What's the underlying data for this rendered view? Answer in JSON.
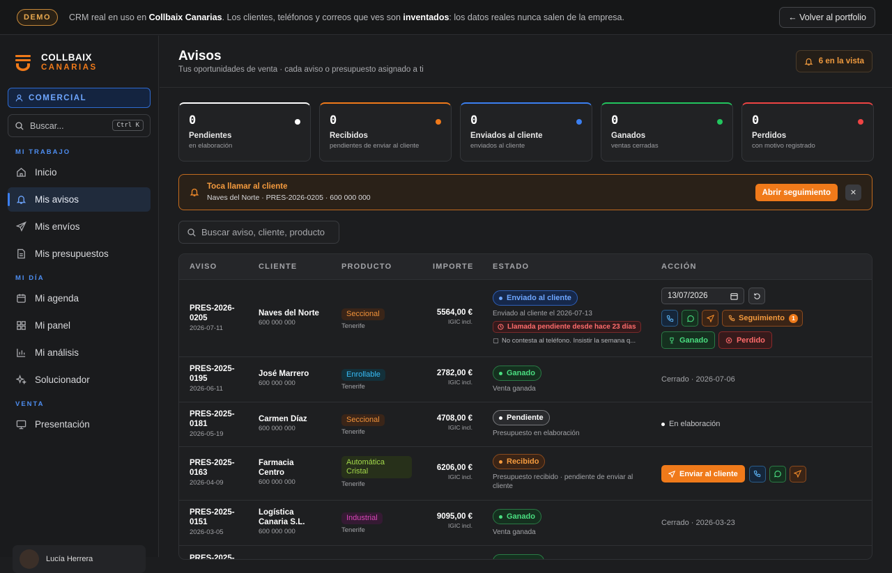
{
  "topbar": {
    "badge": "DEMO",
    "text_pre": "CRM real en uso en ",
    "text_company": "Collbaix Canarias",
    "text_mid": ". Los clientes, teléfonos y correos que ves son ",
    "text_bold": "inventados",
    "text_post": ": los datos reales nunca salen de la empresa.",
    "portfolio_btn": "← Volver al portfolio"
  },
  "sidebar": {
    "brand_line1": "COLLBAIX",
    "brand_line2": "CANARIAS",
    "role": "COMERCIAL",
    "search_placeholder": "Buscar...",
    "search_kbd": "Ctrl K",
    "section_work": "MI TRABAJO",
    "section_day": "MI DÍA",
    "section_sale": "VENTA",
    "items": [
      {
        "label": "Inicio",
        "icon": "home-icon"
      },
      {
        "label": "Mis avisos",
        "icon": "bell-icon"
      },
      {
        "label": "Mis envíos",
        "icon": "send-icon"
      },
      {
        "label": "Mis presupuestos",
        "icon": "document-icon"
      },
      {
        "label": "Mi agenda",
        "icon": "calendar-icon"
      },
      {
        "label": "Mi panel",
        "icon": "grid-icon"
      },
      {
        "label": "Mi análisis",
        "icon": "chart-icon"
      },
      {
        "label": "Solucionador",
        "icon": "sparkle-icon"
      },
      {
        "label": "Presentación",
        "icon": "monitor-icon"
      }
    ],
    "user_name": "Lucía Herrera"
  },
  "header": {
    "title": "Avisos",
    "subtitle": "Tus oportunidades de venta · cada aviso o presupuesto asignado a ti",
    "view_count": "6 en la vista"
  },
  "cards": [
    {
      "num": "0",
      "title": "Pendientes",
      "desc": "en elaboración",
      "color": "#ffffff"
    },
    {
      "num": "0",
      "title": "Recibidos",
      "desc": "pendientes de enviar al cliente",
      "color": "#f07a1a"
    },
    {
      "num": "0",
      "title": "Enviados al cliente",
      "desc": "enviados al cliente",
      "color": "#3b7ff0"
    },
    {
      "num": "0",
      "title": "Ganados",
      "desc": "ventas cerradas",
      "color": "#22c55e"
    },
    {
      "num": "0",
      "title": "Perdidos",
      "desc": "con motivo registrado",
      "color": "#ef4444"
    }
  ],
  "alert": {
    "title": "Toca llamar al cliente",
    "detail": "Naves del Norte · PRES-2026-0205 · 600 000 000",
    "button": "Abrir seguimiento",
    "close": "✕"
  },
  "list_search_placeholder": "Buscar aviso, cliente, producto",
  "table": {
    "headers": [
      "AVISO",
      "CLIENTE",
      "PRODUCTO",
      "IMPORTE",
      "ESTADO",
      "ACCIÓN"
    ],
    "rows": [
      {
        "code1": "PRES-2026-",
        "code2": "0205",
        "date": "2026-07-11",
        "client": "Naves del Norte",
        "phone": "600 000 000",
        "product": "Seccional",
        "region": "Tenerife",
        "amount": "5564,00 €",
        "tax": "IGIC incl.",
        "status": "Enviado al cliente",
        "status_sub": "Enviado al cliente el 2026-07-13",
        "warning": "Llamada pendiente desde hace 23 días",
        "note": "No contesta al teléfono. Insistir la semana q...",
        "action_date": "13/07/2026",
        "follow_label": "Seguimiento",
        "follow_count": "1",
        "won_label": "Ganado",
        "lost_label": "Perdido"
      },
      {
        "code1": "PRES-2025-",
        "code2": "0195",
        "date": "2026-06-11",
        "client": "José Marrero",
        "phone": "600 000 000",
        "product": "Enrollable",
        "region": "Tenerife",
        "amount": "2782,00 €",
        "tax": "IGIC incl.",
        "status": "Ganado",
        "status_sub": "Venta ganada",
        "action": "Cerrado · 2026-07-06"
      },
      {
        "code1": "PRES-2025-",
        "code2": "0181",
        "date": "2026-05-19",
        "client": "Carmen Díaz",
        "phone": "600 000 000",
        "product": "Seccional",
        "region": "Tenerife",
        "amount": "4708,00 €",
        "tax": "IGIC incl.",
        "status": "Pendiente",
        "status_sub": "Presupuesto en elaboración",
        "action": "En elaboración"
      },
      {
        "code1": "PRES-2025-",
        "code2": "0163",
        "date": "2026-04-09",
        "client1": "Farmacia",
        "client2": "Centro",
        "phone": "600 000 000",
        "product1": "Automática",
        "product2": "Cristal",
        "region": "Tenerife",
        "amount": "6206,00 €",
        "tax": "IGIC incl.",
        "status": "Recibido",
        "status_sub1": "Presupuesto recibido · pendiente de enviar al",
        "status_sub2": "cliente",
        "action_btn": "Enviar al cliente"
      },
      {
        "code1": "PRES-2025-",
        "code2": "0151",
        "date": "2026-03-05",
        "client1": "Logística",
        "client2": "Canaria S.L.",
        "phone": "600 000 000",
        "product": "Industrial",
        "region": "Tenerife",
        "amount": "9095,00 €",
        "tax": "IGIC incl.",
        "status": "Ganado",
        "status_sub": "Venta ganada",
        "action": "Cerrado · 2026-03-23"
      },
      {
        "code1": "PRES-2025-"
      }
    ]
  }
}
